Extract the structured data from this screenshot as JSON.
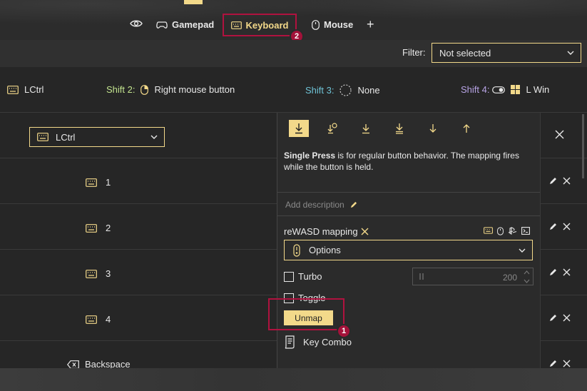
{
  "nav": {
    "tabs": [
      {
        "label": "Gamepad"
      },
      {
        "label": "Keyboard"
      },
      {
        "label": "Mouse"
      }
    ],
    "add_symbol": "+",
    "keyboard_badge": "2"
  },
  "filter": {
    "label": "Filter:",
    "value": "Not selected"
  },
  "shifts": {
    "main_key": "LCtrl",
    "shift2_label": "Shift 2:",
    "shift2_value": "Right mouse button",
    "shift3_label": "Shift 3:",
    "shift3_value": "None",
    "shift4_label": "Shift 4:",
    "shift4_value": "L Win"
  },
  "list": {
    "selected_mapping": "LCtrl",
    "rows": [
      {
        "label": "1"
      },
      {
        "label": "2"
      },
      {
        "label": "3"
      },
      {
        "label": "4"
      },
      {
        "label": "Backspace"
      }
    ]
  },
  "panel": {
    "desc_bold": "Single Press",
    "desc_rest": " is for regular button behavior. The mapping fires while the button is held.",
    "add_description": "Add description",
    "mapping_name": "reWASD mapping",
    "options_value": "Options",
    "turbo_label": "Turbo",
    "turbo_value": "200",
    "toggle_label": "Toggle",
    "unmap_label": "Unmap",
    "unmap_badge": "1",
    "keycombo_label": "Key Combo"
  },
  "colors": {
    "accent": "#f3d98a",
    "highlight": "#b0123f",
    "shift2": "#c3e48f",
    "shift3": "#6fc3d6",
    "shift4": "#b8a4e6"
  }
}
